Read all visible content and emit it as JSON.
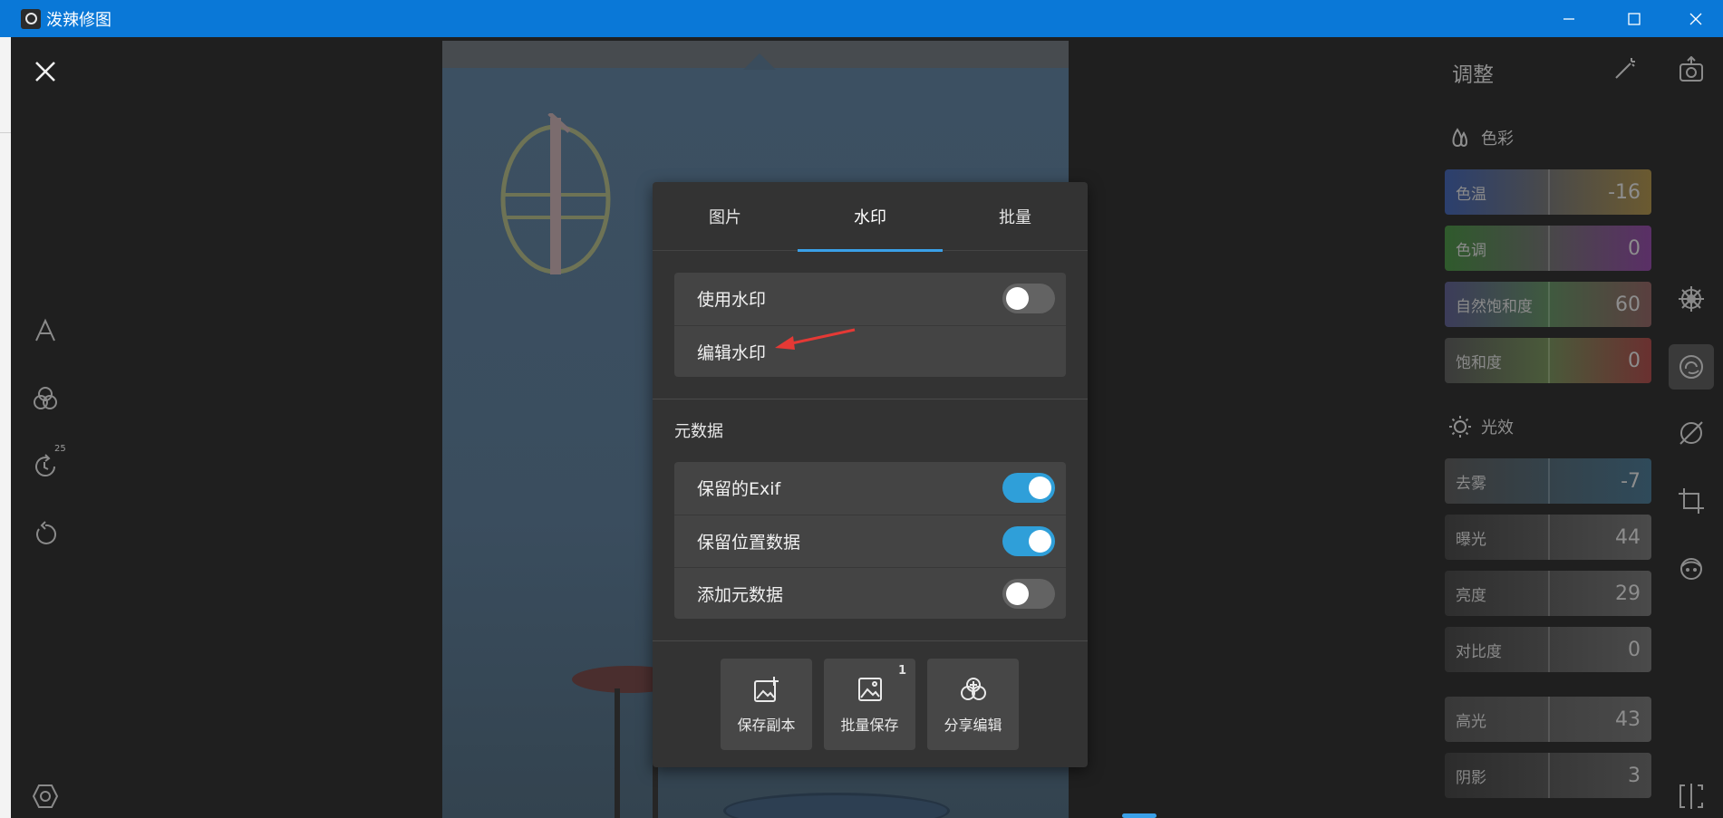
{
  "window": {
    "title": "泼辣修图",
    "app_icon": "circle-app-icon",
    "controls": [
      "minimize-icon",
      "maximize-icon",
      "close-icon"
    ]
  },
  "left_toolbar": {
    "items": [
      "close-icon",
      "text-icon",
      "filter-icon",
      "history-icon",
      "reset-icon",
      "settings-hex-icon"
    ],
    "history_badge": "25"
  },
  "popup": {
    "tabs": [
      {
        "label": "图片",
        "active": false
      },
      {
        "label": "水印",
        "active": true
      },
      {
        "label": "批量",
        "active": false
      }
    ],
    "watermark": {
      "use_label": "使用水印",
      "use_enabled": false,
      "edit_label": "编辑水印"
    },
    "metadata": {
      "section_label": "元数据",
      "rows": [
        {
          "label": "保留的Exif",
          "enabled": true
        },
        {
          "label": "保留位置数据",
          "enabled": true
        },
        {
          "label": "添加元数据",
          "enabled": false
        }
      ]
    },
    "actions": [
      {
        "label": "保存副本",
        "icon": "save-copy-icon"
      },
      {
        "label": "批量保存",
        "icon": "batch-save-icon",
        "count": "1"
      },
      {
        "label": "分享编辑",
        "icon": "share-edit-icon"
      }
    ]
  },
  "adjust_panel": {
    "title": "调整",
    "color_section": "色彩",
    "light_section": "光效",
    "color_sliders": [
      {
        "label": "色温",
        "value": "-16"
      },
      {
        "label": "色调",
        "value": "0"
      },
      {
        "label": "自然饱和度",
        "value": "60"
      },
      {
        "label": "饱和度",
        "value": "0"
      }
    ],
    "light_sliders": [
      {
        "label": "去雾",
        "value": "-7"
      },
      {
        "label": "曝光",
        "value": "44"
      },
      {
        "label": "亮度",
        "value": "29"
      },
      {
        "label": "对比度",
        "value": "0"
      }
    ],
    "tone_sliders": [
      {
        "label": "高光",
        "value": "43"
      },
      {
        "label": "阴影",
        "value": "3"
      }
    ]
  },
  "right_toolbar": {
    "items": [
      "export-icon",
      "detail-wheel-icon",
      "adjust-icon",
      "hsl-icon",
      "crop-icon",
      "face-icon",
      "compare-icon"
    ],
    "active": "adjust-icon"
  },
  "colors": {
    "titlebar": "#0a78d7",
    "accent": "#2f9fd9",
    "arrow": "#e53935"
  }
}
